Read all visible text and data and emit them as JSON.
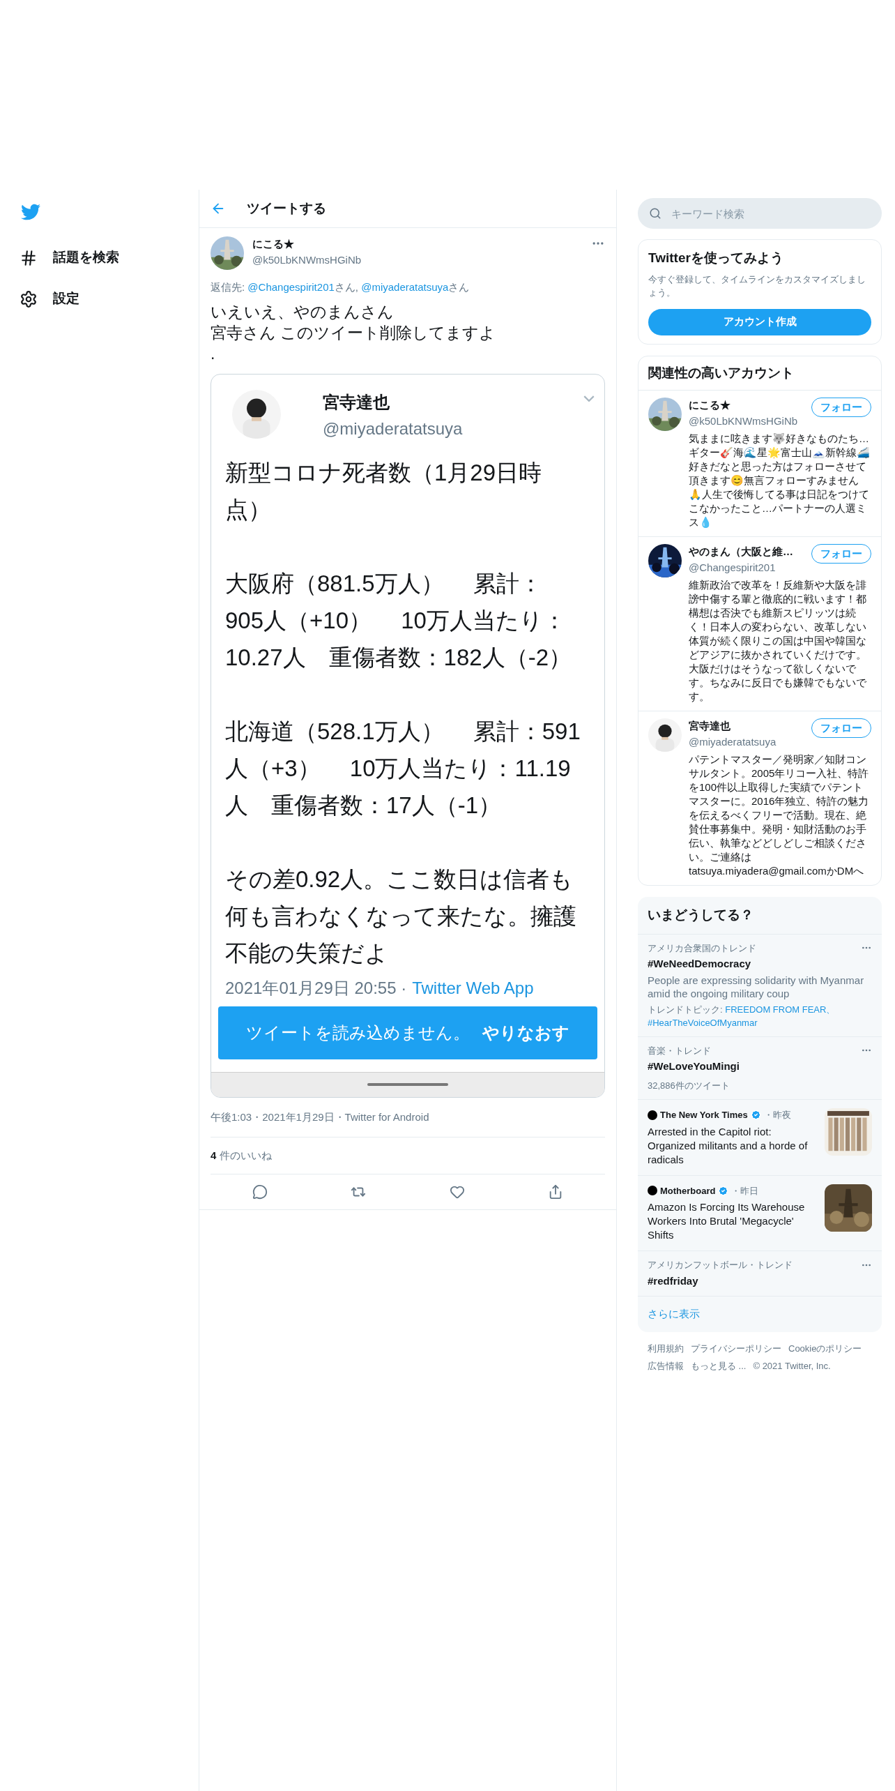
{
  "nav": {
    "items": [
      {
        "kind": "explore",
        "label": "話題を検索"
      },
      {
        "kind": "settings",
        "label": "設定"
      }
    ]
  },
  "header": {
    "title": "ツイートする"
  },
  "tweet": {
    "name": "にこる★",
    "handle": "@k50LbKNWmsHGiNb",
    "reply_to": {
      "prefix": "返信先:",
      "mentions": [
        {
          "handle": "@Changespirit201",
          "suffix": "さん,"
        },
        {
          "handle": "@miyaderatatsuya",
          "suffix": "さん"
        }
      ]
    },
    "text_lines": [
      "いえいえ、やのまんさん",
      "宮寺さん このツイート削除してますよ",
      "."
    ],
    "screenshot": {
      "name": "宮寺達也",
      "handle": "@miyaderatatsuya",
      "paragraphs": [
        [
          "新型コロナ死者数（1月29日時",
          "点）"
        ],
        [
          "大阪府（881.5万人）　 累計：",
          "905人（+10）　 10万人当たり：",
          "10.27人　重傷者数：182人（-2）"
        ],
        [
          "北海道（528.1万人）　 累計：591",
          "人（+3）　 10万人当たり：11.19",
          "人　重傷者数：17人（-1）"
        ],
        [
          "その差0.92人。ここ数日は信者も",
          "何も言わなくなって来たな。擁護",
          "不能の失策だよ"
        ]
      ],
      "timestamp": "2021年01月29日 20:55 ·",
      "source": "Twitter Web App",
      "error": "ツイートを読み込めません。",
      "retry": "やりなおす"
    },
    "meta": "午後1:03・2021年1月29日・Twitter for Android",
    "likes_count": "4",
    "likes_label": "件のいいね"
  },
  "search": {
    "placeholder": "キーワード検索"
  },
  "signup": {
    "title": "Twitterを使ってみよう",
    "text": "今すぐ登録して、タイムラインをカスタマイズしましょう。",
    "button": "アカウント作成"
  },
  "related": {
    "title": "関連性の高いアカウント",
    "accounts": [
      {
        "name": "にこる★",
        "handle": "@k50LbKNWmsHGiNb",
        "follow": "フォロー",
        "bio": "気ままに呟きます🐺好きなものたち…ギター🎸海🌊星🌟富士山🗻新幹線🚄好きだなと思った方はフォローさせて頂きます😊無言フォローすみません🙏人生で後悔してる事は日記をつけてこなかったこと…パートナーの人選ミス💧"
      },
      {
        "name": "やのまん（大阪と維…",
        "handle": "@Changespirit201",
        "follow": "フォロー",
        "bio": "維新政治で改革を！反維新や大阪を誹謗中傷する輩と徹底的に戦います！都構想は否決でも維新スピリッツは続く！日本人の変わらない、改革しない体質が続く限りこの国は中国や韓国などアジアに抜かされていくだけです。大阪だけはそうなって欲しくないです。ちなみに反日でも嫌韓でもないです。"
      },
      {
        "name": "宮寺達也",
        "handle": "@miyaderatatsuya",
        "follow": "フォロー",
        "bio": "パテントマスター／発明家／知財コンサルタント。2005年リコー入社、特許を100件以上取得した実績でパテントマスターに。2016年独立、特許の魅力を伝えるべくフリーで活動。現在、絶賛仕事募集中。発明・知財活動のお手伝い、執筆などどしどしご相談ください。ご連絡は tatsuya.miyadera@gmail.comかDMへ"
      }
    ]
  },
  "trends": {
    "title": "いまどうしてる？",
    "items": [
      {
        "kind": "trend",
        "context": "アメリカ合衆国のトレンド",
        "title": "#WeNeedDemocracy",
        "description": "People are expressing solidarity with Myanmar amid the ongoing military coup",
        "topics_label": "トレンドトピック:",
        "topics": [
          "FREEDOM FROM FEAR、",
          "#HearTheVoiceOfMyanmar"
        ]
      },
      {
        "kind": "trend",
        "context": "音楽・トレンド",
        "title": "#WeLoveYouMingi",
        "count": "32,886件のツイート"
      },
      {
        "kind": "news",
        "source": "The New York Times",
        "time": "・昨夜",
        "headline": "Arrested in the Capitol riot: Organized militants and a horde of radicals"
      },
      {
        "kind": "news",
        "source": "Motherboard",
        "time": "・昨日",
        "headline": "Amazon Is Forcing Its Warehouse Workers Into Brutal 'Megacycle' Shifts"
      },
      {
        "kind": "trend",
        "context": "アメリカンフットボール・トレンド",
        "title": "#redfriday"
      }
    ],
    "more": "さらに表示"
  },
  "footer": {
    "links": [
      "利用規約",
      "プライバシーポリシー",
      "Cookieのポリシー",
      "広告情報",
      "もっと見る ..."
    ],
    "copyright": "© 2021 Twitter, Inc."
  }
}
